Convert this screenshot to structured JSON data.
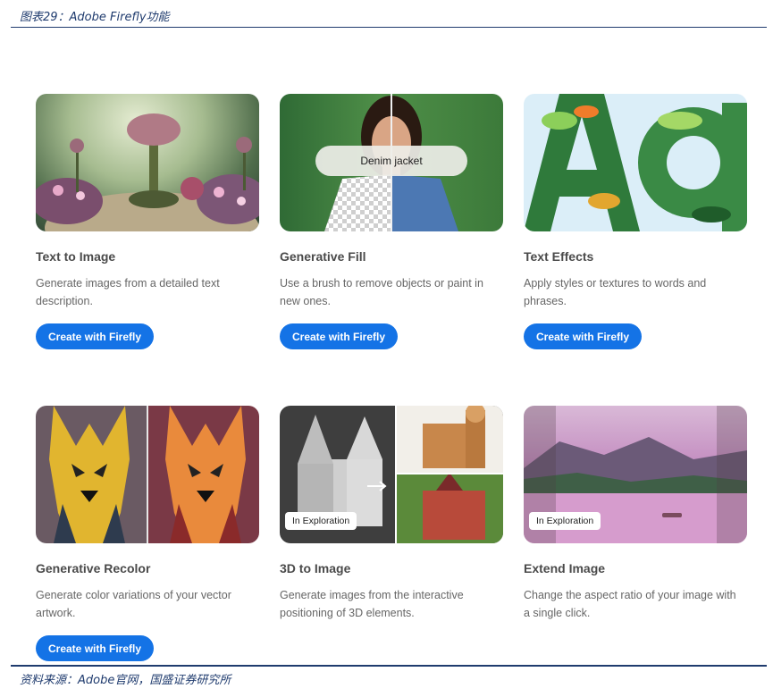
{
  "figure": {
    "title": "图表29：Adobe Firefly功能",
    "source": "资料来源：Adobe官网，国盛证券研究所"
  },
  "cards": [
    {
      "title": "Text to Image",
      "desc": "Generate images from a detailed text description.",
      "button": "Create with Firefly"
    },
    {
      "title": "Generative Fill",
      "desc": "Use a brush to remove objects or paint in new ones.",
      "button": "Create with Firefly",
      "prompt_text": "Denim jacket"
    },
    {
      "title": "Text Effects",
      "desc": "Apply styles or textures to words and phrases.",
      "button": "Create with Firefly"
    },
    {
      "title": "Generative Recolor",
      "desc": "Generate color variations of your vector artwork.",
      "button": "Create with Firefly"
    },
    {
      "title": "3D to Image",
      "desc": "Generate images from the interactive positioning of 3D elements.",
      "badge": "In Exploration"
    },
    {
      "title": "Extend Image",
      "desc": "Change the aspect ratio of your image with a single click.",
      "badge": "In Exploration"
    }
  ],
  "colors": {
    "accent": "#1473e6",
    "rule": "#1f3b6e"
  }
}
